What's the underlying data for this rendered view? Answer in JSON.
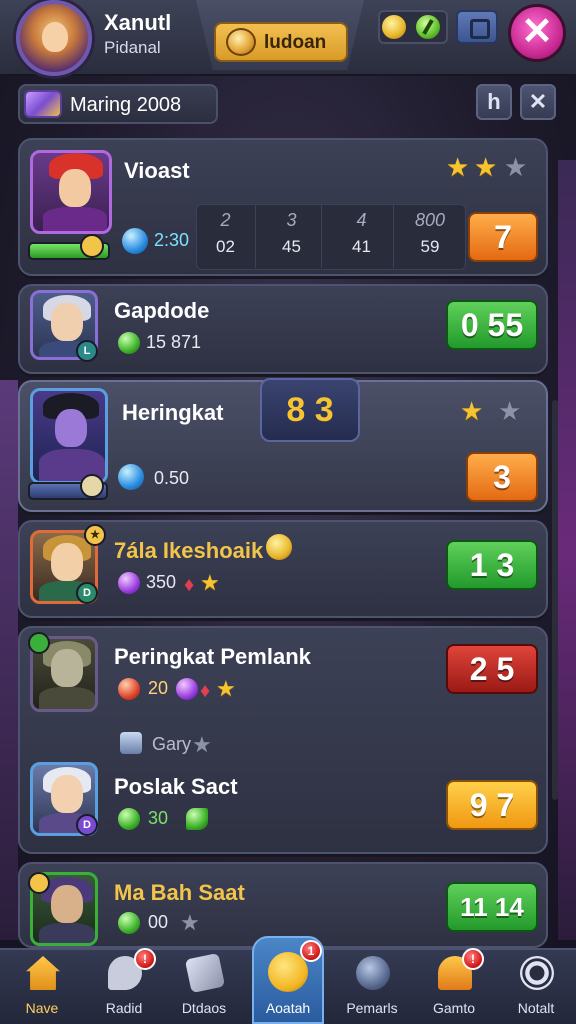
{
  "player": {
    "name": "Xanutl",
    "subtitle": "Pidanal"
  },
  "top_tab": {
    "label": "ludoan"
  },
  "top_buttons": {
    "close": "✕"
  },
  "season": {
    "label": "Maring 2008",
    "btn_a": "h",
    "btn_b": "✕"
  },
  "rows": [
    {
      "name": "Vioast",
      "gem_value": "2:30",
      "stats": [
        {
          "top": "2",
          "bottom": "02"
        },
        {
          "top": "3",
          "bottom": "45"
        },
        {
          "top": "4",
          "bottom": "41"
        },
        {
          "top": "800",
          "bottom": "59"
        }
      ],
      "stars": [
        true,
        true,
        false
      ],
      "score": "7",
      "score_color": "orange"
    },
    {
      "name": "Gapdode",
      "stat": "15 871",
      "score": "0 55",
      "score_color": "green"
    },
    {
      "name": "Heringkat",
      "floating_score": "8 3",
      "gem_value": "0.50",
      "stars": [
        true,
        false
      ],
      "score": "3",
      "score_color": "orange"
    },
    {
      "name": "7ála Ikeshoaik",
      "stat": "350",
      "score": "1 3",
      "score_color": "green"
    },
    {
      "name": "Peringkat Pemlank",
      "stat": "20",
      "sub_label": "Gary",
      "score": "2 5",
      "score_color": "red"
    },
    {
      "name": "Poslak Sact",
      "stat": "30",
      "score": "9 7",
      "score_color": "yellow"
    },
    {
      "name": "Ma Bah Saat",
      "stat": "00",
      "score": "11 14",
      "score_color": "green"
    }
  ],
  "nav": [
    {
      "label": "Nave",
      "icon": "home-icon"
    },
    {
      "label": "Radid",
      "icon": "chat-icon",
      "badge": "!"
    },
    {
      "label": "Dtdaos",
      "icon": "cards-icon"
    },
    {
      "label": "Aoatah",
      "icon": "emoji-icon",
      "badge": "1"
    },
    {
      "label": "Pemarls",
      "icon": "orb-icon"
    },
    {
      "label": "Gamto",
      "icon": "person-icon",
      "badge": "!"
    },
    {
      "label": "Notalt",
      "icon": "target-icon"
    }
  ]
}
